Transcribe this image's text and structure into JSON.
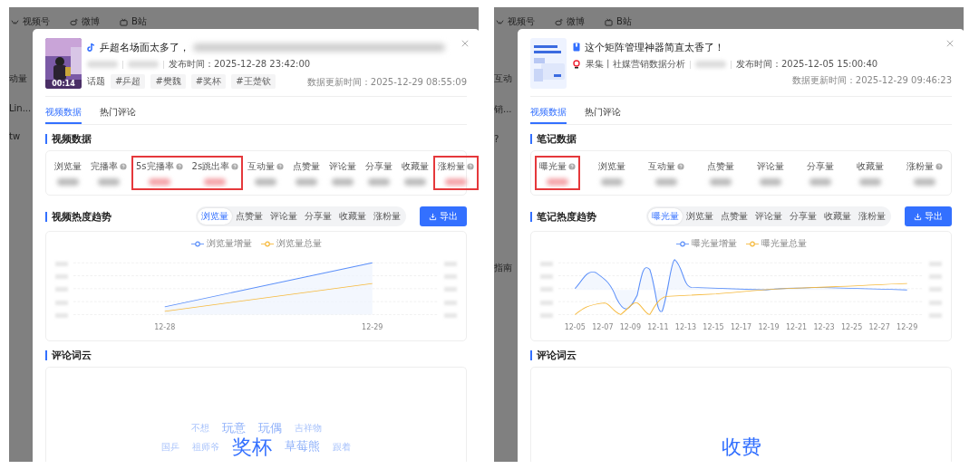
{
  "panels": [
    {
      "nav": [
        "视频号",
        "微博",
        "B站"
      ],
      "edge_texts": [
        "动量",
        "Lin...",
        "tw"
      ],
      "header": {
        "kind": "video",
        "title": "乒超名场面太多了，",
        "title_blurred": true,
        "publish_time": "发布时间：2025-12-28 23:42:00",
        "duration": "00:14",
        "topics_label": "话题",
        "topics": [
          "#乒超",
          "#樊魏",
          "#奖杯",
          "#王楚钦"
        ],
        "update_time": "数据更新时间：2025-12-29 08:55:09"
      },
      "tabs": [
        {
          "label": "视频数据",
          "selected": true
        },
        {
          "label": "热门评论",
          "selected": false
        }
      ],
      "data_title": "视频数据",
      "metric_groups": [
        {
          "highlighted": false,
          "items": [
            {
              "label": "浏览量",
              "help": false
            }
          ]
        },
        {
          "highlighted": false,
          "items": [
            {
              "label": "完播率",
              "help": true
            }
          ]
        },
        {
          "highlighted": true,
          "items": [
            {
              "label": "5s完播率",
              "help": true
            },
            {
              "label": "2s跳出率",
              "help": true
            }
          ]
        },
        {
          "highlighted": false,
          "items": [
            {
              "label": "互动量",
              "help": true
            }
          ]
        },
        {
          "highlighted": false,
          "items": [
            {
              "label": "点赞量",
              "help": false
            }
          ]
        },
        {
          "highlighted": false,
          "items": [
            {
              "label": "评论量",
              "help": false
            }
          ]
        },
        {
          "highlighted": false,
          "items": [
            {
              "label": "分享量",
              "help": false
            }
          ]
        },
        {
          "highlighted": false,
          "items": [
            {
              "label": "收藏量",
              "help": false
            }
          ]
        },
        {
          "highlighted": true,
          "items": [
            {
              "label": "涨粉量",
              "help": true
            }
          ]
        }
      ],
      "trend_title": "视频热度趋势",
      "trend_tabs": [
        {
          "label": "浏览量",
          "selected": true
        },
        {
          "label": "点赞量",
          "selected": false
        },
        {
          "label": "评论量",
          "selected": false
        },
        {
          "label": "分享量",
          "selected": false
        },
        {
          "label": "收藏量",
          "selected": false
        },
        {
          "label": "涨粉量",
          "selected": false
        }
      ],
      "export_label": "导出",
      "chart": {
        "kind": "rise",
        "legend": [
          {
            "name": "浏览量增量",
            "color": "#5b8ff9"
          },
          {
            "name": "浏览量总量",
            "color": "#f6b93b"
          }
        ],
        "x_labels": [
          "12-28",
          "12-29"
        ]
      },
      "cloud_title": "评论词云",
      "cloud_rows": [
        [
          {
            "word": "不想",
            "kind": "small"
          },
          {
            "word": "玩意",
            "kind": "medium"
          },
          {
            "word": "玩偶",
            "kind": "medium"
          },
          {
            "word": "吉祥物",
            "kind": "small"
          }
        ],
        [
          {
            "word": "国乒",
            "kind": "small"
          },
          {
            "word": "祖师爷",
            "kind": "small"
          },
          {
            "word": "奖杯",
            "kind": "large"
          },
          {
            "word": "草莓熊",
            "kind": "medium"
          },
          {
            "word": "跟着",
            "kind": "small"
          }
        ]
      ]
    },
    {
      "nav": [
        "视频号",
        "微博",
        "B站"
      ],
      "edge_texts": [
        "互动",
        "销...",
        "?",
        "指南"
      ],
      "header": {
        "kind": "note",
        "title": "这个矩阵管理神器简直太香了！",
        "title_blurred": false,
        "author": "果集丨社媒营销数据分析",
        "publish_time": "发布时间：2025-12-05 15:00:40",
        "update_time": "数据更新时间：2025-12-29 09:46:23"
      },
      "tabs": [
        {
          "label": "视频数据",
          "selected": true
        },
        {
          "label": "热门评论",
          "selected": false
        }
      ],
      "data_title": "笔记数据",
      "metric_groups": [
        {
          "highlighted": true,
          "items": [
            {
              "label": "曝光量",
              "help": true
            }
          ]
        },
        {
          "highlighted": false,
          "items": [
            {
              "label": "浏览量",
              "help": false
            }
          ]
        },
        {
          "highlighted": false,
          "items": [
            {
              "label": "互动量",
              "help": true
            }
          ]
        },
        {
          "highlighted": false,
          "items": [
            {
              "label": "点赞量",
              "help": false
            }
          ]
        },
        {
          "highlighted": false,
          "items": [
            {
              "label": "评论量",
              "help": false
            }
          ]
        },
        {
          "highlighted": false,
          "items": [
            {
              "label": "分享量",
              "help": false
            }
          ]
        },
        {
          "highlighted": false,
          "items": [
            {
              "label": "收藏量",
              "help": false
            }
          ]
        },
        {
          "highlighted": false,
          "items": [
            {
              "label": "涨粉量",
              "help": true
            }
          ]
        }
      ],
      "trend_title": "笔记热度趋势",
      "trend_tabs": [
        {
          "label": "曝光量",
          "selected": true
        },
        {
          "label": "浏览量",
          "selected": false
        },
        {
          "label": "点赞量",
          "selected": false
        },
        {
          "label": "评论量",
          "selected": false
        },
        {
          "label": "分享量",
          "selected": false
        },
        {
          "label": "收藏量",
          "selected": false
        },
        {
          "label": "涨粉量",
          "selected": false
        }
      ],
      "export_label": "导出",
      "chart": {
        "kind": "spikes",
        "legend": [
          {
            "name": "曝光量增量",
            "color": "#5b8ff9"
          },
          {
            "name": "曝光量总量",
            "color": "#f6b93b"
          }
        ],
        "x_labels": [
          "12-05",
          "12-07",
          "12-09",
          "12-11",
          "12-13",
          "12-15",
          "12-17",
          "12-19",
          "12-21",
          "12-23",
          "12-25",
          "12-27",
          "12-29"
        ]
      },
      "cloud_title": "评论词云",
      "cloud_rows": [
        [
          {
            "word": "收费",
            "kind": "large"
          }
        ]
      ]
    }
  ]
}
